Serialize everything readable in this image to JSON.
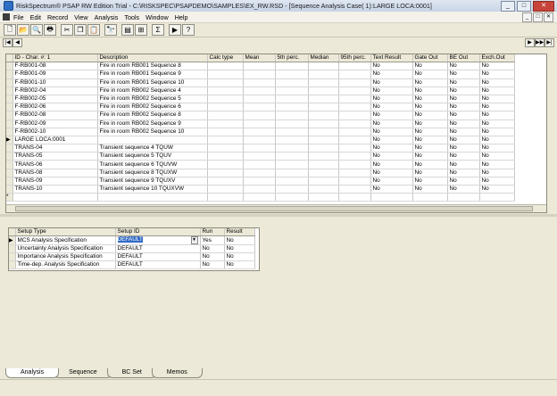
{
  "window": {
    "title": "RiskSpectrum® PSAP RW Edition Trial - C:\\RISKSPEC\\PSAPDEMO\\SAMPLES\\EX_RW.RSD - [Sequence Analysis Case( 1):LARGE LOCA:0001]",
    "minimize": "_",
    "maximize": "□",
    "close": "✕"
  },
  "menu": [
    "File",
    "Edit",
    "Record",
    "View",
    "Analysis",
    "Tools",
    "Window",
    "Help"
  ],
  "toolbar_icons": [
    "new-icon",
    "open-icon",
    "print-preview-icon",
    "print-icon",
    "cut-icon",
    "copy-icon",
    "paste-icon",
    "find-icon",
    "view-icon",
    "tree-icon",
    "filter-icon",
    "run-icon",
    "help-icon"
  ],
  "toolbar_glyphs": [
    "🗋",
    "📂",
    "🔍",
    "🖶",
    "✂",
    "❐",
    "📋",
    "🔭",
    "▤",
    "⊞",
    "Σ",
    "▶",
    "?"
  ],
  "nav": {
    "first": "|◀",
    "prev": "◀",
    "next": "▶",
    "last": "▶|",
    "last2": "▶▶"
  },
  "top_grid": {
    "columns": [
      "ID - Char. #: 1",
      "Description",
      "Calc type",
      "Mean",
      "5th perc.",
      "Median",
      "95th perc.",
      "Text Result",
      "Gate Out",
      "BE Out",
      "Exch.Out"
    ],
    "rows": [
      {
        "id": "F-RB001-08",
        "desc": "Fire in room RB001 Sequence 8",
        "t": "No",
        "g": "No",
        "b": "No",
        "e": "No",
        "cur": false
      },
      {
        "id": "F-RB001-09",
        "desc": "Fire in room RB001 Sequence 9",
        "t": "No",
        "g": "No",
        "b": "No",
        "e": "No",
        "cur": false
      },
      {
        "id": "F-RB001-10",
        "desc": "Fire in room RB001 Sequence 10",
        "t": "No",
        "g": "No",
        "b": "No",
        "e": "No",
        "cur": false
      },
      {
        "id": "F-RB002-04",
        "desc": "Fire in room RB002 Sequence 4",
        "t": "No",
        "g": "No",
        "b": "No",
        "e": "No",
        "cur": false
      },
      {
        "id": "F-RB002-05",
        "desc": "Fire in room RB002 Sequence 5",
        "t": "No",
        "g": "No",
        "b": "No",
        "e": "No",
        "cur": false
      },
      {
        "id": "F-RB002-06",
        "desc": "Fire in room RB002 Sequence 6",
        "t": "No",
        "g": "No",
        "b": "No",
        "e": "No",
        "cur": false
      },
      {
        "id": "F-RB002-08",
        "desc": "Fire in room RB002 Sequence 8",
        "t": "No",
        "g": "No",
        "b": "No",
        "e": "No",
        "cur": false
      },
      {
        "id": "F-RB002-09",
        "desc": "Fire in room RB002 Sequence 9",
        "t": "No",
        "g": "No",
        "b": "No",
        "e": "No",
        "cur": false
      },
      {
        "id": "F-RB002-10",
        "desc": "Fire in room RB002 Sequence 10",
        "t": "No",
        "g": "No",
        "b": "No",
        "e": "No",
        "cur": false
      },
      {
        "id": "LARGE LOCA:0001",
        "desc": "",
        "t": "No",
        "g": "No",
        "b": "No",
        "e": "No",
        "cur": true
      },
      {
        "id": "TRANS-04",
        "desc": "Transient sequence 4 TQUW",
        "t": "No",
        "g": "No",
        "b": "No",
        "e": "No",
        "cur": false
      },
      {
        "id": "TRANS-05",
        "desc": "Transient sequence 5 TQUV",
        "t": "No",
        "g": "No",
        "b": "No",
        "e": "No",
        "cur": false
      },
      {
        "id": "TRANS-06",
        "desc": "Transient sequence 6 TQUVW",
        "t": "No",
        "g": "No",
        "b": "No",
        "e": "No",
        "cur": false
      },
      {
        "id": "TRANS-08",
        "desc": "Transient sequence 8 TQUXW",
        "t": "No",
        "g": "No",
        "b": "No",
        "e": "No",
        "cur": false
      },
      {
        "id": "TRANS-09",
        "desc": "Transient sequence 9 TQUXV",
        "t": "No",
        "g": "No",
        "b": "No",
        "e": "No",
        "cur": false
      },
      {
        "id": "TRANS-10",
        "desc": "Transient sequence 10 TQUXVW",
        "t": "No",
        "g": "No",
        "b": "No",
        "e": "No",
        "cur": false
      }
    ],
    "new_row_marker": "*"
  },
  "bottom_grid": {
    "columns": [
      "Setup Type",
      "Setup ID",
      "Run",
      "Result"
    ],
    "rows": [
      {
        "type": "MCS Analysis Specification",
        "id": "DEFAULT",
        "run": "Yes",
        "result": "No",
        "cur": true
      },
      {
        "type": "Uncertainty Analysis Specification",
        "id": "DEFAULT",
        "run": "No",
        "result": "No",
        "cur": false
      },
      {
        "type": "Importance Analysis Specification",
        "id": "DEFAULT",
        "run": "No",
        "result": "No",
        "cur": false
      },
      {
        "type": "Time-dep. Analysis Specification",
        "id": "DEFAULT",
        "run": "No",
        "result": "No",
        "cur": false
      }
    ]
  },
  "tabs": [
    "Analysis",
    "Sequence",
    "BC Set",
    "Memos"
  ],
  "active_tab": "Analysis"
}
